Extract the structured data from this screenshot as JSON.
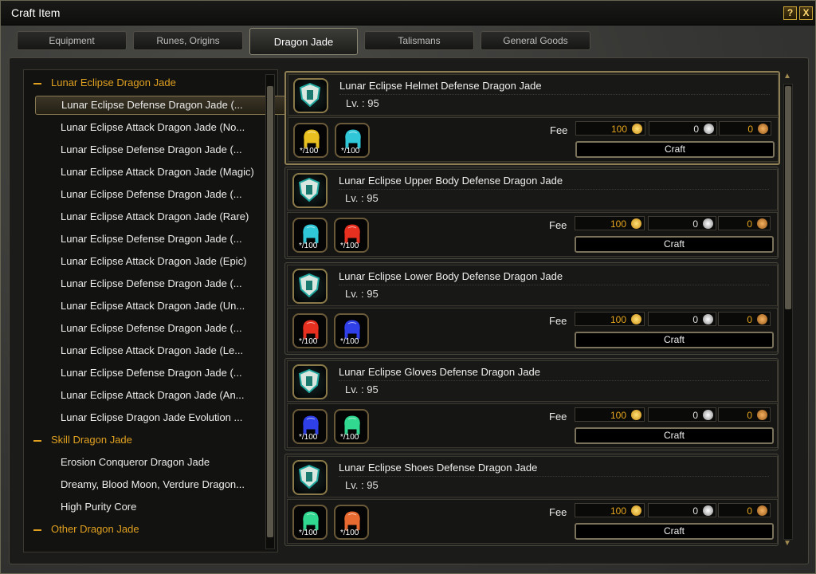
{
  "window": {
    "title": "Craft Item",
    "help_label": "?",
    "close_label": "X"
  },
  "tabs": [
    {
      "label": "Equipment"
    },
    {
      "label": "Runes, Origins"
    },
    {
      "label": "Dragon Jade"
    },
    {
      "label": "Talismans"
    },
    {
      "label": "General Goods"
    }
  ],
  "tree": {
    "cat1": "Lunar Eclipse Dragon Jade",
    "items1": [
      "Lunar Eclipse Defense Dragon Jade (...",
      "Lunar Eclipse Attack Dragon Jade (No...",
      "Lunar Eclipse Defense Dragon Jade (...",
      "Lunar Eclipse Attack Dragon Jade (Magic)",
      "Lunar Eclipse Defense Dragon Jade (...",
      "Lunar Eclipse Attack Dragon Jade (Rare)",
      "Lunar Eclipse Defense Dragon Jade (...",
      "Lunar Eclipse Attack Dragon Jade (Epic)",
      "Lunar Eclipse Defense Dragon Jade (...",
      "Lunar Eclipse Attack Dragon Jade (Un...",
      "Lunar Eclipse Defense Dragon Jade (...",
      "Lunar Eclipse Attack Dragon Jade (Le...",
      "Lunar Eclipse Defense Dragon Jade (...",
      "Lunar Eclipse Attack Dragon Jade (An...",
      "Lunar Eclipse Dragon Jade Evolution ..."
    ],
    "cat2": "Skill Dragon Jade",
    "items2": [
      "Erosion Conqueror Dragon Jade",
      "Dreamy, Blood Moon, Verdure Dragon...",
      "High Purity Core"
    ],
    "cat3": "Other Dragon Jade"
  },
  "recipes": [
    {
      "name": "Lunar Eclipse Helmet Defense Dragon Jade",
      "level": "Lv. : 95",
      "mat1_count": "*/100",
      "mat2_count": "*/100",
      "fee_label": "Fee",
      "gold": "100",
      "silver": "0",
      "copper": "0",
      "craft_label": "Craft"
    },
    {
      "name": "Lunar Eclipse Upper Body Defense Dragon Jade",
      "level": "Lv. : 95",
      "mat1_count": "*/100",
      "mat2_count": "*/100",
      "fee_label": "Fee",
      "gold": "100",
      "silver": "0",
      "copper": "0",
      "craft_label": "Craft"
    },
    {
      "name": "Lunar Eclipse Lower Body Defense Dragon Jade",
      "level": "Lv. : 95",
      "mat1_count": "*/100",
      "mat2_count": "*/100",
      "fee_label": "Fee",
      "gold": "100",
      "silver": "0",
      "copper": "0",
      "craft_label": "Craft"
    },
    {
      "name": "Lunar Eclipse Gloves Defense Dragon Jade",
      "level": "Lv. : 95",
      "mat1_count": "*/100",
      "mat2_count": "*/100",
      "fee_label": "Fee",
      "gold": "100",
      "silver": "0",
      "copper": "0",
      "craft_label": "Craft"
    },
    {
      "name": "Lunar Eclipse Shoes Defense Dragon Jade",
      "level": "Lv. : 95",
      "mat1_count": "*/100",
      "mat2_count": "*/100",
      "fee_label": "Fee",
      "gold": "100",
      "silver": "0",
      "copper": "0",
      "craft_label": "Craft"
    }
  ],
  "colors": {
    "accent": "#e0a020",
    "gold": "#e6a51c",
    "border": "#8e7e54"
  },
  "icons": {
    "gem_colors": [
      [
        "#e8c020",
        "#30c8d8"
      ],
      [
        "#30c8d8",
        "#e83020"
      ],
      [
        "#e83020",
        "#3040e8"
      ],
      [
        "#3040e8",
        "#30d890"
      ],
      [
        "#30d890",
        "#e86a30"
      ]
    ]
  }
}
